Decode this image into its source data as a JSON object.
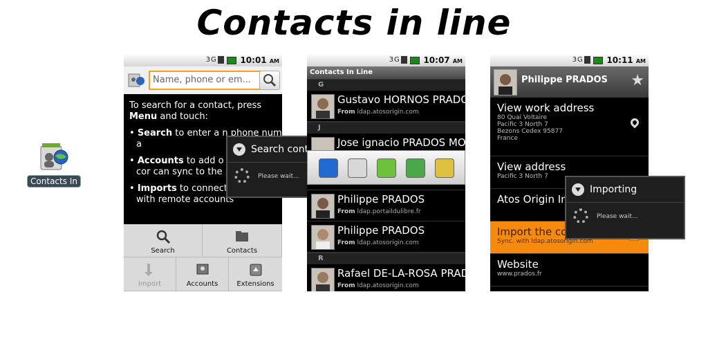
{
  "title": "Contacts in line",
  "launcher": {
    "label": "Contacts In"
  },
  "statusbar": {
    "time1": "10:01",
    "time2": "10:07",
    "time3": "10:11",
    "ampm": "AM",
    "net": "3G"
  },
  "screen1": {
    "search_placeholder": "Name, phone or em...",
    "intro": "To search for a contact, press",
    "intro_menu": "Menu",
    "intro_tail": " and touch:",
    "bullets": [
      {
        "key": "Search",
        "text": " to enter a n phone number or a"
      },
      {
        "key": "Accounts",
        "text": " to add o an account with cor can sync to the pho"
      },
      {
        "key": "Imports",
        "text": " to connect internal contact with remote accounts"
      }
    ],
    "dialog_title": "Search conta",
    "dialog_body": "Please wait...",
    "menu": [
      "Search",
      "Contacts",
      "Import",
      "Accounts",
      "Extensions"
    ]
  },
  "screen2": {
    "header": "Contacts In Line",
    "sections": [
      "G",
      "J",
      "R"
    ],
    "rows": [
      {
        "name": "Gustavo HORNOS PRADOS",
        "from": "ldap.atosorigin.com"
      },
      {
        "name": "Jose ignacio PRADOS MOL",
        "from": ""
      },
      {
        "name": "Philippe PRADOS",
        "from": "ldap.portaildulibre.fr"
      },
      {
        "name": "Philippe PRADOS",
        "from": "ldap.atosorigin.com"
      },
      {
        "name": "Rafael DE-LA-ROSA PRADOS",
        "from": "ldap.atosorigin.com"
      }
    ],
    "from_label": "From"
  },
  "screen3": {
    "name": "Philippe PRADOS",
    "items": [
      {
        "title": "View work address",
        "detail": [
          "80 Quai Voltaire",
          "Pacific 3 North 7",
          "Bezons Cedex 95877",
          "France"
        ]
      },
      {
        "title": "View address",
        "detail": [
          "Pacific 3 North 7"
        ]
      },
      {
        "title": "Atos Origin In",
        "detail": []
      },
      {
        "title": "Import the contacts",
        "detail": [
          "Sync. with ldap.atosorigin.com"
        ]
      },
      {
        "title": "Website",
        "detail": [
          "www.prados.fr"
        ]
      }
    ],
    "dialog_title": "Importing",
    "dialog_body": "Please wait...",
    "ghost1": "iew address",
    "ghost2": "Origin Intég. SAS"
  }
}
